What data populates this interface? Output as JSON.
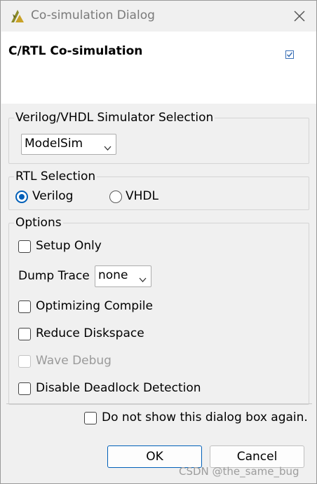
{
  "window": {
    "title": "Co-simulation Dialog",
    "icons": {
      "app": "xilinx-logo-icon",
      "close": "close-icon"
    },
    "accent_color": "#005fb8"
  },
  "header": {
    "title": "C/RTL Co-simulation",
    "checked": true
  },
  "simulator": {
    "group_label": "Verilog/VHDL Simulator Selection",
    "selected": "ModelSim"
  },
  "rtl": {
    "group_label": "RTL Selection",
    "options": [
      {
        "label": "Verilog",
        "selected": true
      },
      {
        "label": "VHDL",
        "selected": false
      }
    ]
  },
  "options": {
    "group_label": "Options",
    "setup_only": {
      "label": "Setup Only",
      "checked": false
    },
    "dump_trace": {
      "label": "Dump Trace",
      "value": "none"
    },
    "optimizing_compile": {
      "label": "Optimizing Compile",
      "checked": false
    },
    "reduce_diskspace": {
      "label": "Reduce Diskspace",
      "checked": false
    },
    "wave_debug": {
      "label": "Wave Debug",
      "checked": false,
      "disabled": true
    },
    "disable_deadlock": {
      "label": "Disable Deadlock Detection",
      "checked": false
    }
  },
  "footer": {
    "dont_show_label": "Do not show this dialog box again.",
    "dont_show_checked": false,
    "ok_label": "OK",
    "cancel_label": "Cancel"
  },
  "watermark": "CSDN @the_same_bug"
}
